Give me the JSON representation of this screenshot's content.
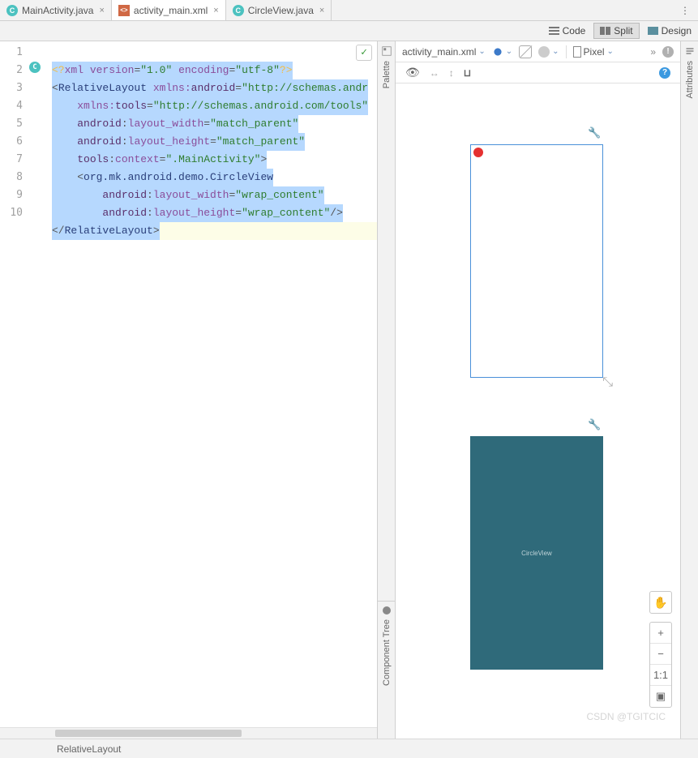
{
  "tabs": {
    "t0": {
      "label": "MainActivity.java"
    },
    "t1": {
      "label": "activity_main.xml"
    },
    "t2": {
      "label": "CircleView.java"
    }
  },
  "viewmode": {
    "code": "Code",
    "split": "Split",
    "design": "Design"
  },
  "code": {
    "ln1": "1",
    "ln2": "2",
    "ln3": "3",
    "ln4": "4",
    "ln5": "5",
    "ln6": "6",
    "ln7": "7",
    "ln8": "8",
    "ln9": "9",
    "ln10": "10",
    "l1_a": "<?",
    "l1_b": "xml version",
    "l1_c": "=",
    "l1_d": "\"1.0\"",
    "l1_e": " encoding",
    "l1_f": "=",
    "l1_g": "\"utf-8\"",
    "l1_h": "?>",
    "l2_a": "<",
    "l2_b": "RelativeLayout",
    "l2_c": " ",
    "l2_d": "xmlns:",
    "l2_e": "android",
    "l2_f": "=",
    "l2_g": "\"http://schemas.andr",
    "l3_a": "    ",
    "l3_b": "xmlns:",
    "l3_c": "tools",
    "l3_d": "=",
    "l3_e": "\"http://schemas.android.com/tools\"",
    "l4_a": "    ",
    "l4_b": "android",
    "l4_c": ":",
    "l4_d": "layout_width",
    "l4_e": "=",
    "l4_f": "\"match_parent\"",
    "l5_a": "    ",
    "l5_b": "android",
    "l5_c": ":",
    "l5_d": "layout_height",
    "l5_e": "=",
    "l5_f": "\"match_parent\"",
    "l6_a": "    ",
    "l6_b": "tools",
    "l6_c": ":",
    "l6_d": "context",
    "l6_e": "=",
    "l6_f": "\".MainActivity\"",
    "l6_g": ">",
    "l7_a": "    <",
    "l7_b": "org.mk.android.demo.CircleView",
    "l8_a": "        ",
    "l8_b": "android",
    "l8_c": ":",
    "l8_d": "layout_width",
    "l8_e": "=",
    "l8_f": "\"wrap_content\"",
    "l9_a": "        ",
    "l9_b": "android",
    "l9_c": ":",
    "l9_d": "layout_height",
    "l9_e": "=",
    "l9_f": "\"wrap_content\"",
    "l9_g": "/>",
    "l10_a": "</",
    "l10_b": "RelativeLayout",
    "l10_c": ">"
  },
  "palette_label": "Palette",
  "comptree_label": "Component Tree",
  "attributes_label": "Attributes",
  "preview": {
    "file_dropdown": "activity_main.xml",
    "device": "Pixel",
    "circleview_label": "CircleView"
  },
  "zoom": {
    "plus": "+",
    "minus": "−",
    "fit": "1:1"
  },
  "status": {
    "breadcrumb": "RelativeLayout"
  },
  "watermark": "CSDN @TGITCIC"
}
